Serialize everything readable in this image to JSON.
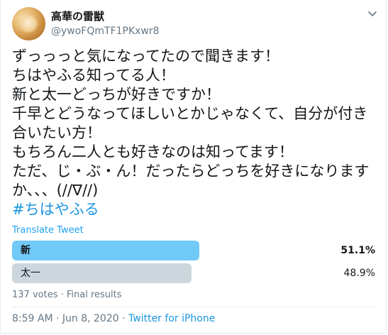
{
  "author": {
    "display_name": "高華の雷獣",
    "handle": "@ywoFQmTF1PKxwr8"
  },
  "tweet": {
    "lines": [
      "ずっっっと気になってたので聞きます！",
      "ちはやふる知ってる人！",
      "新と太一どっちが好きですか！",
      "千早とどうなってほしいとかじゃなくて、自分が付き",
      "合いたい方！",
      "もちろん二人とも好きなのは知ってます！",
      "ただ、じ・ぶ・ん！だったらどっちを好きになります",
      "か、、、(//∇//)"
    ],
    "hashtag": "#ちはやふる",
    "translate_label": "Translate Tweet"
  },
  "poll": {
    "options": [
      {
        "label": "新",
        "percent_text": "51.1%",
        "percent": 51.1,
        "color": "#71c9f8",
        "winner": true
      },
      {
        "label": "太一",
        "percent_text": "48.9%",
        "percent": 48.9,
        "color": "#ccd6dd",
        "winner": false
      }
    ],
    "summary": "137 votes · Final results"
  },
  "footer": {
    "time_date": "8:59 AM · Jun 8, 2020 · ",
    "source": "Twitter for iPhone"
  },
  "icons": {
    "menu": "chevron-down-icon"
  }
}
